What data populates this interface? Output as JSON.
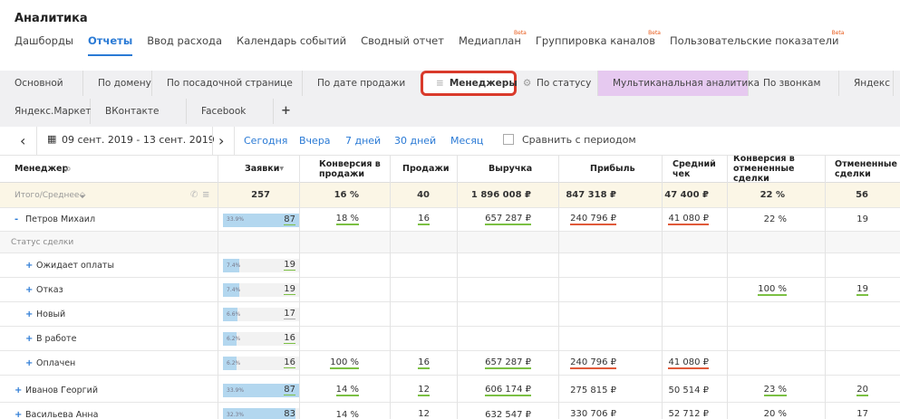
{
  "app_title": "Аналитика",
  "topnav": [
    {
      "label": "Дашборды",
      "active": false,
      "beta": ""
    },
    {
      "label": "Отчеты",
      "active": true,
      "beta": ""
    },
    {
      "label": "Ввод расхода",
      "active": false,
      "beta": ""
    },
    {
      "label": "Календарь событий",
      "active": false,
      "beta": ""
    },
    {
      "label": "Сводный отчет",
      "active": false,
      "beta": ""
    },
    {
      "label": "Медиаплан",
      "active": false,
      "beta": "Beta"
    },
    {
      "label": "Группировка каналов",
      "active": false,
      "beta": "Beta"
    },
    {
      "label": "Пользовательские показатели",
      "active": false,
      "beta": "Beta"
    }
  ],
  "tabs_row1": [
    "Основной",
    "По домену",
    "По посадочной странице",
    "По дате продажи",
    "Менеджеры",
    "По статусу",
    "Мультиканальная аналитика",
    "По звонкам",
    "Яндекс"
  ],
  "tabs_row2": [
    "Яндекс.Маркет",
    "ВКонтакте",
    "Facebook",
    "+"
  ],
  "dates": {
    "range": "09 сент. 2019 - 13 сент. 2019",
    "quick": [
      "Сегодня",
      "Вчера",
      "7 дней",
      "30 дней",
      "Месяц"
    ],
    "compare": "Сравнить с периодом"
  },
  "columns": {
    "manager": "Менеджер",
    "leads": "Заявки",
    "conv_sales": "Конверсия в продажи",
    "sales": "Продажи",
    "revenue": "Выручка",
    "profit": "Прибыль",
    "avg_check": "Средний чек",
    "conv_cancel": "Конверсия в отмененные сделки",
    "cancelled": "Отмененные сделки"
  },
  "totals": {
    "label": "Итого/Среднее",
    "leads": "257",
    "conv_sales": "16 %",
    "sales": "40",
    "revenue": "1 896 008 ₽",
    "profit": "847 318 ₽",
    "avg_check": "47 400 ₽",
    "conv_cancel": "22 %",
    "cancelled": "56"
  },
  "group_label": "Статус сделки",
  "rows": [
    {
      "toggle": "-",
      "name": "Петров Михаил",
      "pct": "33.9%",
      "leads": "87",
      "share": 0.339,
      "conv_sales": "18 %",
      "sales": "16",
      "revenue": "657 287 ₽",
      "profit": "240 796 ₽",
      "avg_check": "41 080 ₽",
      "conv_cancel": "22 %",
      "cancelled": "19",
      "indent": false
    },
    {
      "toggle": "+",
      "name": "Ожидает оплаты",
      "pct": "7.4%",
      "leads": "19",
      "share": 0.074,
      "conv_sales": "",
      "sales": "",
      "revenue": "",
      "profit": "",
      "avg_check": "",
      "conv_cancel": "",
      "cancelled": "",
      "indent": true
    },
    {
      "toggle": "+",
      "name": "Отказ",
      "pct": "7.4%",
      "leads": "19",
      "share": 0.074,
      "conv_sales": "",
      "sales": "",
      "revenue": "",
      "profit": "",
      "avg_check": "",
      "conv_cancel": "100 %",
      "cancelled": "19",
      "indent": true
    },
    {
      "toggle": "+",
      "name": "Новый",
      "pct": "6.6%",
      "leads": "17",
      "share": 0.066,
      "conv_sales": "",
      "sales": "",
      "revenue": "",
      "profit": "",
      "avg_check": "",
      "conv_cancel": "",
      "cancelled": "",
      "indent": true
    },
    {
      "toggle": "+",
      "name": "В работе",
      "pct": "6.2%",
      "leads": "16",
      "share": 0.062,
      "conv_sales": "",
      "sales": "",
      "revenue": "",
      "profit": "",
      "avg_check": "",
      "conv_cancel": "",
      "cancelled": "",
      "indent": true
    },
    {
      "toggle": "+",
      "name": "Оплачен",
      "pct": "6.2%",
      "leads": "16",
      "share": 0.062,
      "conv_sales": "100 %",
      "sales": "16",
      "revenue": "657 287 ₽",
      "profit": "240 796 ₽",
      "avg_check": "41 080 ₽",
      "conv_cancel": "",
      "cancelled": "",
      "indent": true
    },
    {
      "toggle": "+",
      "name": "Иванов Георгий",
      "pct": "33.9%",
      "leads": "87",
      "share": 0.339,
      "conv_sales": "14 %",
      "sales": "12",
      "revenue": "606 174 ₽",
      "profit": "275 815 ₽",
      "avg_check": "50 514 ₽",
      "conv_cancel": "23 %",
      "cancelled": "20",
      "indent": false
    },
    {
      "toggle": "+",
      "name": "Васильева Анна",
      "pct": "32.3%",
      "leads": "83",
      "share": 0.323,
      "conv_sales": "14 %",
      "sales": "12",
      "revenue": "632 547 ₽",
      "profit": "330 706 ₽",
      "avg_check": "52 712 ₽",
      "conv_cancel": "20 %",
      "cancelled": "17",
      "indent": false
    }
  ],
  "colors": {
    "accent": "#2a7ad5",
    "highlight": "#d93a2b",
    "multichannel": "#e6c9f0",
    "totals_bg": "#fbf6e6",
    "bar": "#b3d7ef",
    "beta": "#e85a1a"
  }
}
